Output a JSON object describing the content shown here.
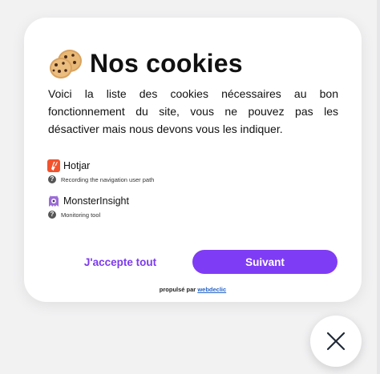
{
  "modal": {
    "title": "Nos cookies",
    "title_icon": "cookie-emoji",
    "description": "Voici la liste des cookies nécessaires au bon fonctionnement du site, vous ne pouvez pas les désactiver mais nous devons vous les indiquer."
  },
  "cookies": [
    {
      "name": "Hotjar",
      "icon": "hotjar-logo",
      "description": "Recording the navigation user path",
      "help_icon": "question-icon"
    },
    {
      "name": "MonsterInsight",
      "icon": "monsterinsight-logo",
      "description": "Monitoring tool",
      "help_icon": "question-icon"
    }
  ],
  "actions": {
    "accept_label": "J'accepte tout",
    "next_label": "Suivant"
  },
  "footer": {
    "powered_prefix": "propulsé par",
    "powered_link": "webdeclic"
  },
  "close_button": {
    "icon": "close-icon"
  },
  "colors": {
    "accent": "#7f3cf5",
    "link": "#2563c7",
    "hotjar": "#f2532d",
    "monsterinsight": "#9b6cd6"
  }
}
